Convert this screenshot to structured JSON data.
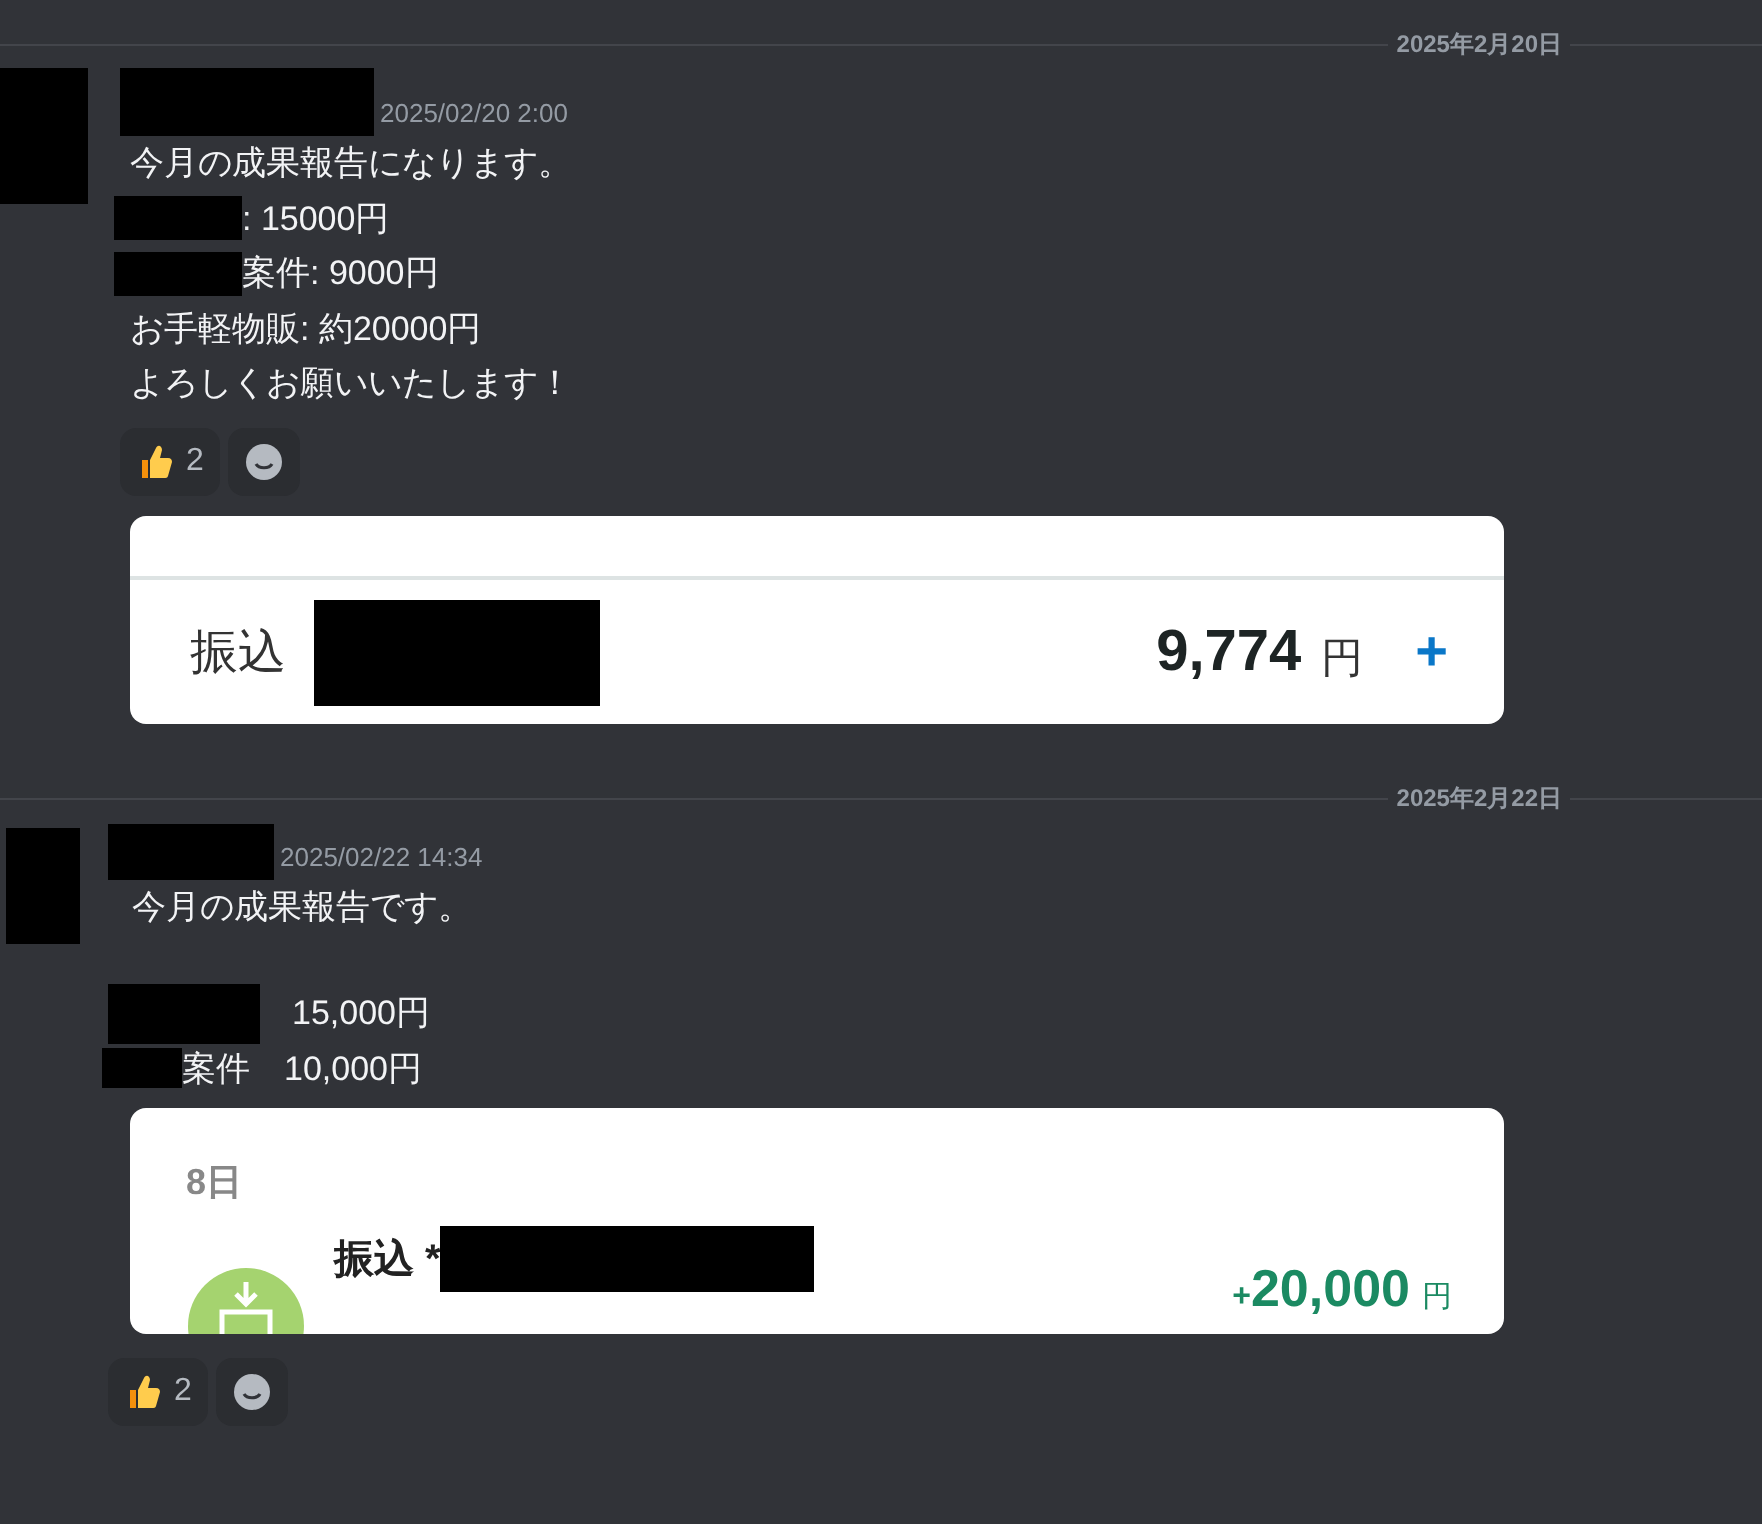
{
  "sections": [
    {
      "date": "2025年2月20日",
      "message": {
        "timestamp": "2025/02/20 2:00",
        "lines": [
          {
            "kind": "text",
            "text": "今月の成果報告になります。"
          },
          {
            "kind": "redacted_text",
            "text": ": 15000円"
          },
          {
            "kind": "redacted_text",
            "text": "案件: 9000円"
          },
          {
            "kind": "text",
            "text": "お手軽物販: 約20000円"
          },
          {
            "kind": "text",
            "text": "よろしくお願いいたします！"
          }
        ],
        "blocks": [
          {
            "kind": "reactions",
            "count": "2"
          },
          {
            "kind": "transfer_card",
            "title": "振込",
            "amount": "9,774",
            "unit": "円",
            "action": "+"
          }
        ]
      }
    },
    {
      "date": "2025年2月22日",
      "message": {
        "timestamp": "2025/02/22 14:34",
        "lines": [
          {
            "kind": "text",
            "text": "今月の成果報告です。"
          },
          {
            "kind": "blank"
          },
          {
            "kind": "redacted_text",
            "text": "15,000円"
          },
          {
            "kind": "redacted_text",
            "text": "案件　10,000円"
          }
        ],
        "blocks": [
          {
            "kind": "deposit_card",
            "day": "8日",
            "title": "振込 *",
            "sign": "+",
            "amount": "20,000",
            "unit": "円"
          },
          {
            "kind": "reactions",
            "count": "2"
          }
        ]
      }
    }
  ]
}
